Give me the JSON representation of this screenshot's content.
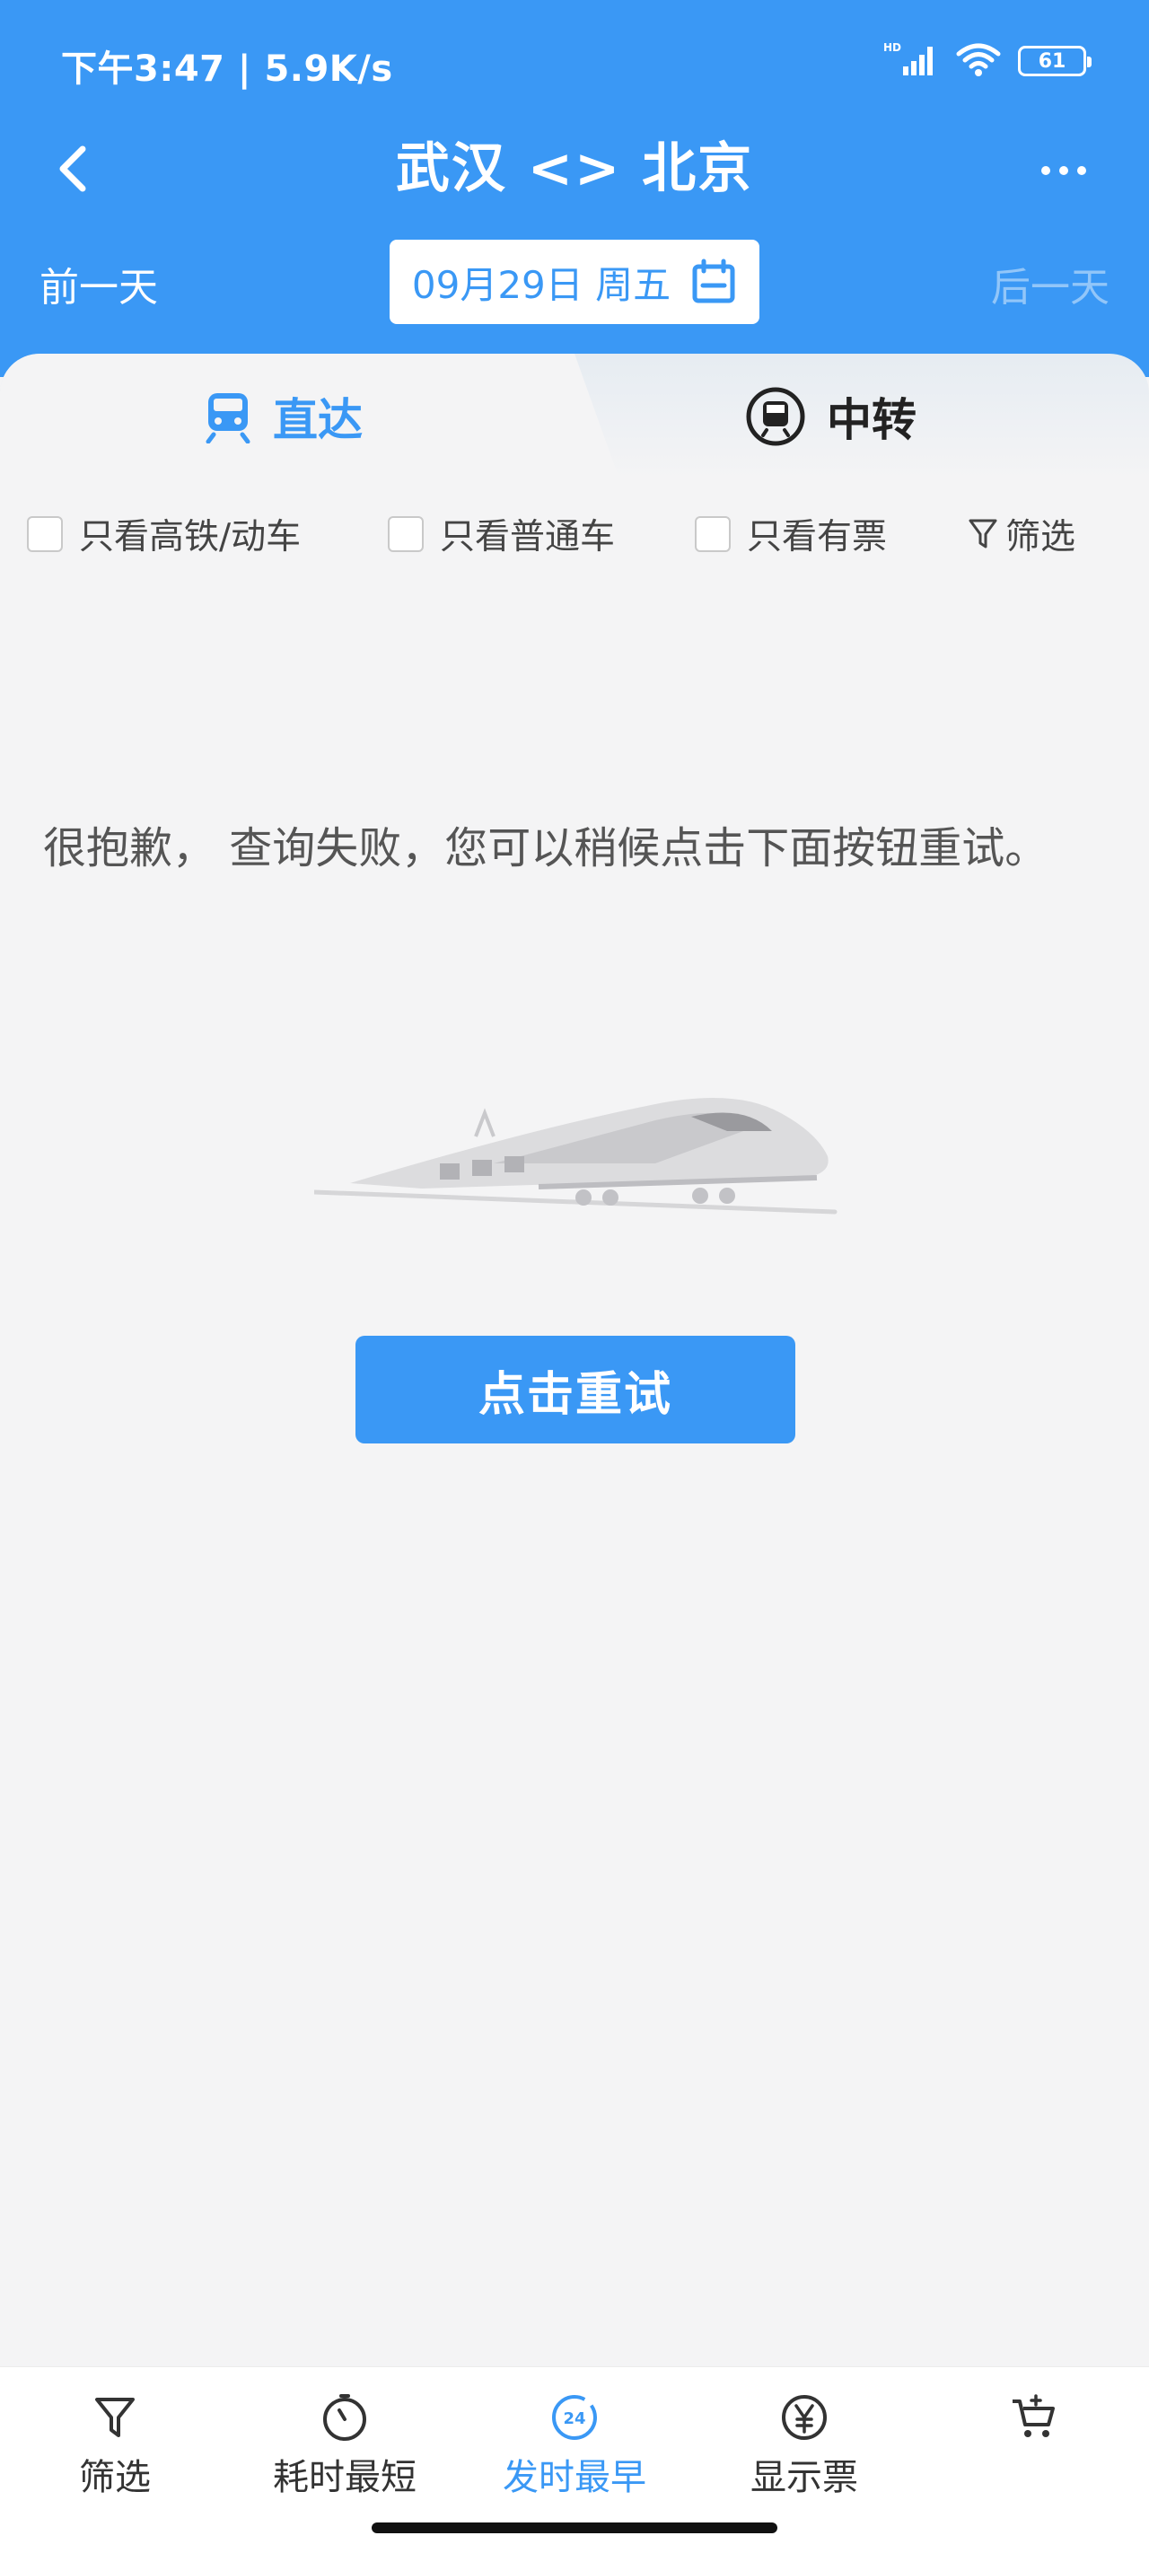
{
  "status_bar": {
    "time": "下午3:47 | 5.9K/s",
    "battery": "61",
    "network_label": "HD"
  },
  "nav": {
    "title": "武汉 <> 北京"
  },
  "date_bar": {
    "prev_day": "前一天",
    "date": "09月29日 周五",
    "next_day": "后一天"
  },
  "tabs": [
    {
      "label": "直达",
      "active": true
    },
    {
      "label": "中转",
      "active": false
    }
  ],
  "filters": {
    "high_speed_only": "只看高铁/动车",
    "regular_only": "只看普通车",
    "available_only": "只看有票",
    "filter": "筛选"
  },
  "error": {
    "message": "很抱歉， 查询失败，您可以稍候点击下面按钮重试。",
    "retry_button": "点击重试"
  },
  "bottom_bar": {
    "items": [
      {
        "label": "筛选",
        "icon": "funnel-icon"
      },
      {
        "label": "耗时最短",
        "icon": "stopwatch-icon"
      },
      {
        "label": "发时最早",
        "icon": "clock-24-icon",
        "active": true,
        "badge": "24"
      },
      {
        "label": "显示票",
        "icon": "yen-icon"
      },
      {
        "label": "",
        "icon": "cart-icon"
      }
    ]
  },
  "colors": {
    "brand_blue": "#3a98f5",
    "background": "#f4f4f5"
  }
}
